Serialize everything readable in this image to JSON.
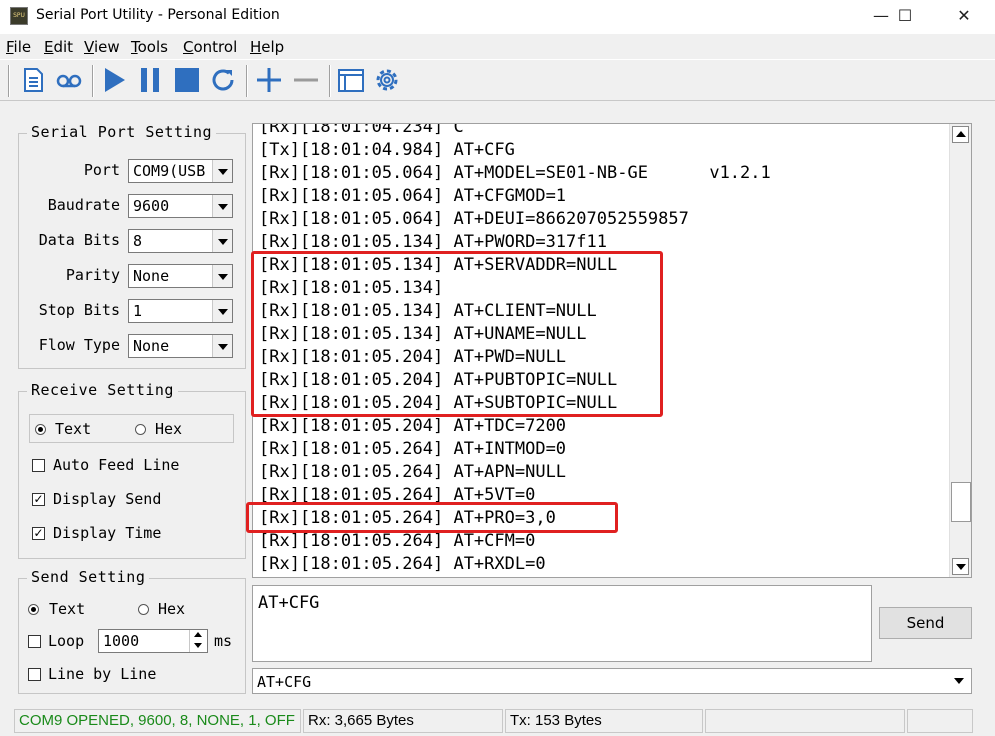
{
  "window": {
    "title": "Serial Port Utility - Personal Edition",
    "app_icon_text": "SPU",
    "minimize_glyph": "—",
    "maximize_glyph": "☐",
    "close_glyph": "✕"
  },
  "menu": [
    {
      "key": "F",
      "rest": "ile"
    },
    {
      "key": "E",
      "rest": "dit"
    },
    {
      "key": "V",
      "rest": "iew"
    },
    {
      "key": "T",
      "rest": "ools"
    },
    {
      "key": "C",
      "rest": "ontrol"
    },
    {
      "key": "H",
      "rest": "elp"
    }
  ],
  "toolbar": {
    "icons": [
      "new-document-icon",
      "record-icon",
      "play-icon",
      "pause-icon",
      "stop-icon",
      "refresh-icon",
      "add-icon",
      "remove-icon",
      "window-icon",
      "settings-icon"
    ],
    "accent_color": "#2f6fbf"
  },
  "serial_port": {
    "title": "Serial Port Setting",
    "fields": [
      {
        "label": "Port",
        "value": "COM9(USB"
      },
      {
        "label": "Baudrate",
        "value": "9600"
      },
      {
        "label": "Data Bits",
        "value": "8"
      },
      {
        "label": "Parity",
        "value": "None"
      },
      {
        "label": "Stop Bits",
        "value": "1"
      },
      {
        "label": "Flow Type",
        "value": "None"
      }
    ]
  },
  "receive": {
    "title": "Receive Setting",
    "mode_text": "Text",
    "mode_hex": "Hex",
    "auto_feed": "Auto Feed Line",
    "display_send": "Display Send",
    "display_time": "Display Time",
    "check_glyph": "✓"
  },
  "send_setting": {
    "title": "Send Setting",
    "mode_text": "Text",
    "mode_hex": "Hex",
    "loop_label": "Loop",
    "loop_value": "1000",
    "loop_unit": "ms",
    "line_by_line": "Line by Line"
  },
  "log_lines": [
    "[Rx][18:01:04.234] C",
    "[Tx][18:01:04.984] AT+CFG",
    "[Rx][18:01:05.064] AT+MODEL=SE01-NB-GE      v1.2.1",
    "[Rx][18:01:05.064] AT+CFGMOD=1",
    "[Rx][18:01:05.064] AT+DEUI=866207052559857",
    "[Rx][18:01:05.134] AT+PWORD=317f11",
    "[Rx][18:01:05.134] AT+SERVADDR=NULL",
    "[Rx][18:01:05.134]",
    "[Rx][18:01:05.134] AT+CLIENT=NULL",
    "[Rx][18:01:05.134] AT+UNAME=NULL",
    "[Rx][18:01:05.204] AT+PWD=NULL",
    "[Rx][18:01:05.204] AT+PUBTOPIC=NULL",
    "[Rx][18:01:05.204] AT+SUBTOPIC=NULL",
    "[Rx][18:01:05.204] AT+TDC=7200",
    "[Rx][18:01:05.264] AT+INTMOD=0",
    "[Rx][18:01:05.264] AT+APN=NULL",
    "[Rx][18:01:05.264] AT+5VT=0",
    "[Rx][18:01:05.264] AT+PRO=3,0",
    "[Rx][18:01:05.264] AT+CFM=0",
    "[Rx][18:01:05.264] AT+RXDL=0"
  ],
  "highlight_color": "#e02020",
  "send_input": {
    "value": "AT+CFG"
  },
  "send_button": "Send",
  "history_value": "AT+CFG",
  "status": {
    "port_status": "COM9 OPENED, 9600, 8, NONE, 1, OFF",
    "port_status_color": "#1a8a1a",
    "rx": "Rx: 3,665 Bytes",
    "tx": "Tx: 153 Bytes"
  }
}
